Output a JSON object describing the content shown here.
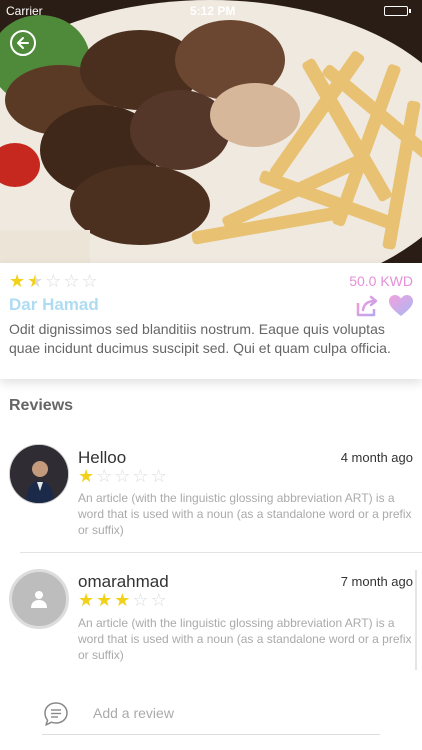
{
  "status_bar": {
    "carrier": "Carrier",
    "time": "5:12 PM"
  },
  "restaurant": {
    "rating": 1.5,
    "name": "Dar Hamad",
    "price": "50.0 KWD",
    "description": "Odit dignissimos sed blanditiis nostrum. Eaque quis voluptas quae incidunt ducimus suscipit sed. Qui et quam culpa officia."
  },
  "reviews_title": "Reviews",
  "reviews": [
    {
      "name": "Helloo",
      "time": "4 month ago",
      "rating": 1,
      "text": "An article (with the linguistic glossing abbreviation ART) is a word that is used with a noun (as a standalone word or a prefix or suffix)"
    },
    {
      "name": "omarahmad",
      "time": "7 month ago",
      "rating": 3,
      "text": "An article (with the linguistic glossing abbreviation ART) is a word that is used with a noun (as a standalone word or a prefix or suffix)"
    }
  ],
  "add_review": {
    "placeholder": "Add a review"
  },
  "colors": {
    "star": "#f2d11b",
    "price": "#e58fd9",
    "name": "#aedcf2",
    "heart": "#c7a9f0"
  },
  "icons": {
    "back": "back-arrow-icon",
    "share": "share-icon",
    "favorite": "heart-icon",
    "chat": "chat-icon"
  }
}
